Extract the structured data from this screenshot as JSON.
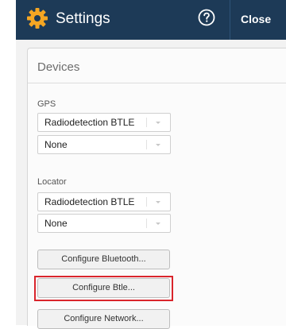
{
  "header": {
    "title": "Settings",
    "help_icon": "help-icon",
    "close_label": "Close",
    "settings_icon": "gear-icon"
  },
  "devices": {
    "section_title": "Devices",
    "gps": {
      "label": "GPS",
      "primary_value": "Radiodetection BTLE",
      "secondary_value": "None"
    },
    "locator": {
      "label": "Locator",
      "primary_value": "Radiodetection BTLE",
      "secondary_value": "None"
    },
    "buttons": {
      "bluetooth": "Configure Bluetooth...",
      "btle": "Configure Btle...",
      "network": "Configure Network..."
    }
  },
  "colors": {
    "header_bg": "#1d3a57",
    "gear_orange": "#f5a623",
    "highlight_red": "#d9252c"
  }
}
